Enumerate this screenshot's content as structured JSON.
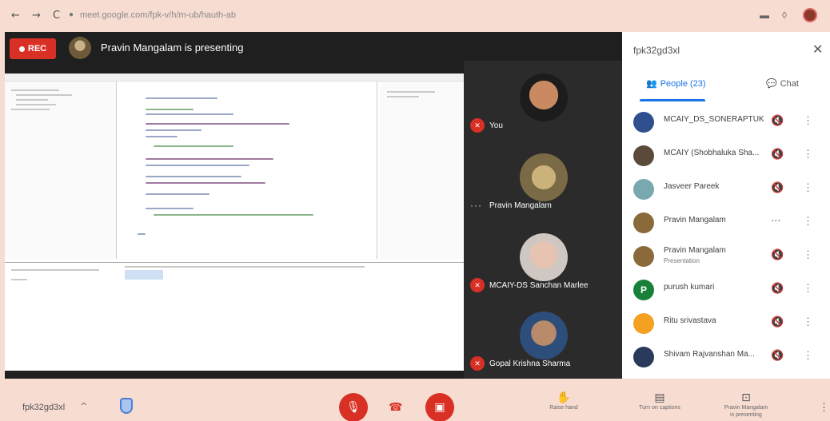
{
  "browser": {
    "back": "←",
    "forward": "→",
    "reload": "C",
    "url": "meet.google.com/fpk-v/h/m-ub/hauth-ab",
    "minimize_icon": "▬",
    "window_icon": "◊"
  },
  "stage": {
    "rec_label": "REC",
    "presenter_title": "Pravin Mangalam is presenting"
  },
  "tiles": [
    {
      "name": "You",
      "muted": true
    },
    {
      "name": "Pravin Mangalam",
      "muted": false,
      "speaking_dots": "···"
    },
    {
      "name": "MCAIY-DS Sanchan Marlee",
      "muted": true
    },
    {
      "name": "Gopal Krishna Sharma",
      "muted": true
    }
  ],
  "panel": {
    "meeting_code": "fpk32gd3xl",
    "close": "✕",
    "tab_people": "People (23)",
    "tab_chat": "Chat",
    "participants": [
      {
        "name": "MCAIY_DS_SONERAPTUK",
        "sub": "",
        "initial": "",
        "color": "#2f4f8f",
        "control": "mic-off"
      },
      {
        "name": "MCAIY (Shobhaluka Sha...",
        "sub": "",
        "initial": "",
        "color": "#5a4a3a",
        "control": "mic-off"
      },
      {
        "name": "Jasveer Pareek",
        "sub": "",
        "initial": "",
        "color": "#7aa8b0",
        "control": "mic-off"
      },
      {
        "name": "Pravin Mangalam",
        "sub": "",
        "initial": "",
        "color": "#8a6a3a",
        "control": "more-dots"
      },
      {
        "name": "Pravin Mangalam",
        "sub": "Presentation",
        "initial": "",
        "color": "#8a6a3a",
        "control": "mic-off"
      },
      {
        "name": "purush kumari",
        "sub": "",
        "initial": "P",
        "color": "#188038",
        "control": "mic-off"
      },
      {
        "name": "Ritu srivastava",
        "sub": "",
        "initial": "",
        "color": "#f4a020",
        "control": "mic-off"
      },
      {
        "name": "Shivam Rajvanshan Ma...",
        "sub": "",
        "initial": "",
        "color": "#2a3a5a",
        "control": "mic-off"
      }
    ]
  },
  "controls": {
    "meeting_code": "fpk32gd3xl",
    "caret": "^",
    "mic_icon": "mic-off-icon",
    "camera_icon": "camera-off-icon",
    "hangup_icon": "phone-icon",
    "raise_hand": "Raise hand",
    "captions": "Turn on captions",
    "presenting_line1": "Pravin Mangalam",
    "presenting_line2": "is presenting",
    "more": "⋮"
  }
}
